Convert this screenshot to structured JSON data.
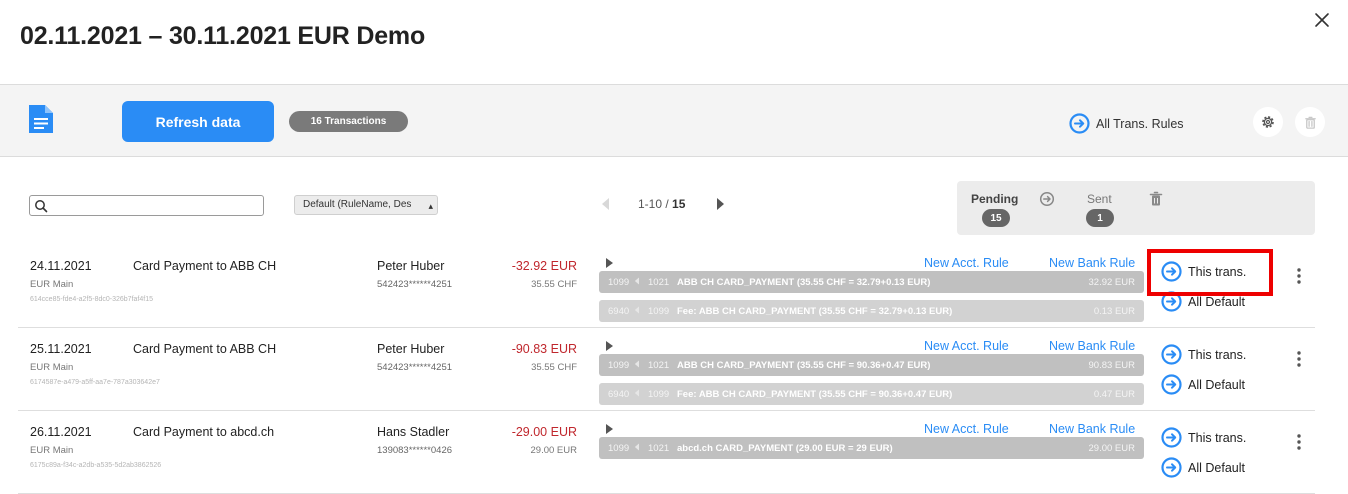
{
  "title": "02.11.2021 – 30.11.2021 EUR Demo",
  "toolbar": {
    "refresh_label": "Refresh data",
    "transactions_badge": "16 Transactions",
    "all_rules_label": "All Trans. Rules"
  },
  "filters": {
    "search_value": "",
    "sort_value": "Default (RuleName, Des",
    "pager_range": "1-10 /",
    "pager_total": "15"
  },
  "status": {
    "pending_label": "Pending",
    "pending_count": "15",
    "sent_label": "Sent",
    "sent_count": "1"
  },
  "colors": {
    "accent": "#2a8cf5",
    "negative_amount": "#c0272d",
    "highlight": "#ee0000"
  },
  "rows": [
    {
      "date": "24.11.2021",
      "account": "EUR Main",
      "guid": "614cce85-fde4-a2f5-8dc0-326b7faf4f15",
      "description": "Card Payment to ABB CH",
      "name": "Peter Huber",
      "card": "542423******4251",
      "amount": "-32.92 EUR",
      "orig_amount": "35.55 CHF",
      "new_acct_rule": "New Acct. Rule",
      "new_bank_rule": "New Bank Rule",
      "this_trans": "This trans.",
      "all_default": "All Default",
      "bookings": [
        {
          "from": "1099",
          "to": "1021",
          "text": "ABB CH CARD_PAYMENT (35.55 CHF = 32.79+0.13 EUR)",
          "amount": "32.92 EUR"
        },
        {
          "from": "6940",
          "to": "1099",
          "text": "Fee: ABB CH CARD_PAYMENT (35.55 CHF = 32.79+0.13 EUR)",
          "amount": "0.13 EUR"
        }
      ]
    },
    {
      "date": "25.11.2021",
      "account": "EUR Main",
      "guid": "6174587e-a479-a5ff-aa7e-787a303642e7",
      "description": "Card Payment to ABB CH",
      "name": "Peter Huber",
      "card": "542423******4251",
      "amount": "-90.83 EUR",
      "orig_amount": "35.55 CHF",
      "new_acct_rule": "New Acct. Rule",
      "new_bank_rule": "New Bank Rule",
      "this_trans": "This trans.",
      "all_default": "All Default",
      "bookings": [
        {
          "from": "1099",
          "to": "1021",
          "text": "ABB CH CARD_PAYMENT (35.55 CHF = 90.36+0.47 EUR)",
          "amount": "90.83 EUR"
        },
        {
          "from": "6940",
          "to": "1099",
          "text": "Fee: ABB CH CARD_PAYMENT (35.55 CHF = 90.36+0.47 EUR)",
          "amount": "0.47 EUR"
        }
      ]
    },
    {
      "date": "26.11.2021",
      "account": "EUR Main",
      "guid": "6175c89a-f34c-a2db-a535-5d2ab3862526",
      "description": "Card Payment to abcd.ch",
      "name": "Hans Stadler",
      "card": "139083******0426",
      "amount": "-29.00 EUR",
      "orig_amount": "29.00 EUR",
      "new_acct_rule": "New Acct. Rule",
      "new_bank_rule": "New Bank Rule",
      "this_trans": "This trans.",
      "all_default": "All Default",
      "bookings": [
        {
          "from": "1099",
          "to": "1021",
          "text": "abcd.ch CARD_PAYMENT (29.00 EUR = 29 EUR)",
          "amount": "29.00 EUR"
        }
      ]
    }
  ]
}
